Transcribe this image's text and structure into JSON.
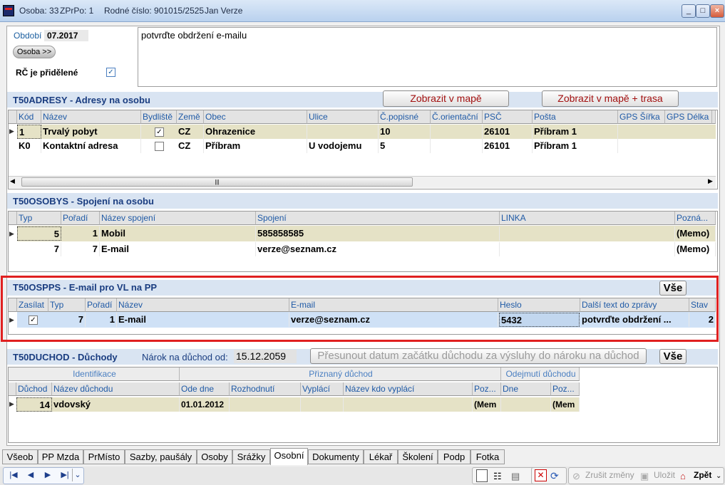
{
  "titlebar": {
    "osoba": "Osoba: 33",
    "zprpo": "ZPrPo: 1",
    "rc": "Rodné číslo: 901015/2525",
    "name": "Jan Verze"
  },
  "header": {
    "obdobi_label": "Období",
    "obdobi_value": "07.2017",
    "osoba_button": "Osoba >>",
    "rc_label": "RČ je přidělené",
    "rc_checked": "✓",
    "memo": "potvrďte obdržení e-mailu"
  },
  "adresy": {
    "title": "T50ADRESY - Adresy na osobu",
    "btn_map": "Zobrazit v mapě",
    "btn_map_route": "Zobrazit v mapě + trasa",
    "columns": [
      "Kód",
      "Název",
      "Bydliště",
      "Země",
      "Obec",
      "Ulice",
      "Č.popisné",
      "Č.orientační",
      "PSČ",
      "Pošta",
      "GPS Šířka",
      "GPS Délka"
    ],
    "rows": [
      {
        "kod": "1",
        "nazev": "Trvalý pobyt",
        "bydliste": "✓",
        "zeme": "CZ",
        "obec": "Ohrazenice",
        "ulice": "",
        "popisne": "10",
        "orient": "",
        "psc": "26101",
        "posta": "Příbram 1"
      },
      {
        "kod": "K0",
        "nazev": "Kontaktní adresa",
        "bydliste": "",
        "zeme": "CZ",
        "obec": "Příbram",
        "ulice": "U vodojemu",
        "popisne": "5",
        "orient": "",
        "psc": "26101",
        "posta": "Příbram 1"
      }
    ]
  },
  "osobys": {
    "title": "T50OSOBYS - Spojení na osobu",
    "columns": [
      "Typ",
      "Pořadí",
      "Název spojení",
      "Spojení",
      "LINKA",
      "Pozná..."
    ],
    "rows": [
      {
        "typ": "5",
        "poradi": "1",
        "nazev": "Mobil",
        "spojeni": "585858585",
        "linka": "",
        "pozn": "(Memo)"
      },
      {
        "typ": "7",
        "poradi": "7",
        "nazev": "E-mail",
        "spojeni": "verze@seznam.cz",
        "linka": "",
        "pozn": "(Memo)"
      }
    ]
  },
  "ospps": {
    "title": "T50OSPPS - E-mail pro VL na PP",
    "btn_all": "Vše",
    "columns": [
      "Zasílat",
      "Typ",
      "Pořadí",
      "Název",
      "E-mail",
      "Heslo",
      "Další text do zprávy",
      "Stav"
    ],
    "rows": [
      {
        "zasilat": "✓",
        "typ": "7",
        "poradi": "1",
        "nazev": "E-mail",
        "email": "verze@seznam.cz",
        "heslo": "5432",
        "text": "potvrďte obdržení ...",
        "stav": "2"
      }
    ]
  },
  "duchod": {
    "title": "T50DUCHOD - Důchody",
    "narok_label": "Nárok na důchod od:",
    "narok_value": "15.12.2059",
    "btn_move": "Přesunout datum začátku důchodu za výsluhy do nároku na důchod",
    "btn_all": "Vše",
    "group_ident": "Identifikace",
    "group_priznany": "Přiznaný důchod",
    "group_odejmuti": "Odejmutí důchodu",
    "columns": [
      "Důchod",
      "Název důchodu",
      "Ode dne",
      "Rozhodnutí",
      "Vyplácí",
      "Název kdo vyplácí",
      "Poz...",
      "Dne",
      "Poz..."
    ],
    "rows": [
      {
        "duchod": "14",
        "nazev": "vdovský",
        "ode": "01.01.2012",
        "rozh": "",
        "vyplaci": "",
        "kdo": "",
        "poz": "(Mem",
        "dne": "",
        "poz2": "(Mem"
      }
    ]
  },
  "tabs": [
    "Všeob",
    "PP Mzda",
    "PrMísto",
    "Sazby, paušály",
    "Osoby",
    "Srážky",
    "Osobní",
    "Dokumenty",
    "Lékař",
    "Školení",
    "Podp",
    "Fotka"
  ],
  "active_tab": "Osobní",
  "toolbar": {
    "cancel": "Zrušit změny",
    "save": "Uložit",
    "back": "Zpět"
  },
  "colors": {
    "section_bg": "#d9e4f2",
    "highlight_border": "#e02020",
    "selected_row": "#e5e2c6"
  }
}
